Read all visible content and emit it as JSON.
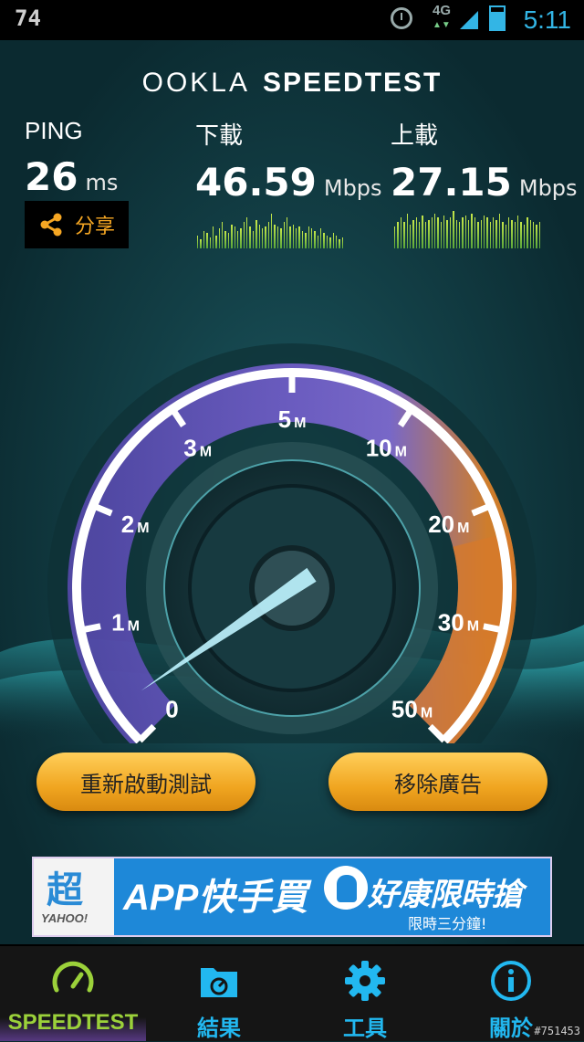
{
  "status_bar": {
    "left_number": "74",
    "network": "4G",
    "clock": "5:11"
  },
  "app": {
    "logo_brand": "OOKLA",
    "logo_product": "SPEEDTEST",
    "ping": {
      "label": "PING",
      "value": "26",
      "unit": "ms"
    },
    "download": {
      "label": "下載",
      "value": "46.59",
      "unit": "Mbps"
    },
    "upload": {
      "label": "上載",
      "value": "27.15",
      "unit": "Mbps"
    },
    "share_label": "分享",
    "download_spark": [
      0.3,
      0.2,
      0.4,
      0.35,
      0.25,
      0.5,
      0.3,
      0.45,
      0.6,
      0.4,
      0.35,
      0.55,
      0.5,
      0.4,
      0.45,
      0.6,
      0.7,
      0.5,
      0.4,
      0.65,
      0.55,
      0.45,
      0.5,
      0.6,
      0.8,
      0.55,
      0.5,
      0.45,
      0.6,
      0.7,
      0.5,
      0.55,
      0.45,
      0.5,
      0.4,
      0.35,
      0.5,
      0.45,
      0.4,
      0.3,
      0.45,
      0.35,
      0.3,
      0.25,
      0.35,
      0.3,
      0.2,
      0.25
    ],
    "upload_spark": [
      0.5,
      0.6,
      0.7,
      0.6,
      0.8,
      0.55,
      0.65,
      0.7,
      0.6,
      0.75,
      0.6,
      0.65,
      0.7,
      0.8,
      0.7,
      0.6,
      0.75,
      0.65,
      0.7,
      0.85,
      0.65,
      0.6,
      0.7,
      0.75,
      0.65,
      0.8,
      0.7,
      0.6,
      0.65,
      0.75,
      0.7,
      0.6,
      0.7,
      0.65,
      0.8,
      0.6,
      0.55,
      0.7,
      0.65,
      0.6,
      0.75,
      0.6,
      0.55,
      0.7,
      0.65,
      0.6,
      0.55,
      0.6
    ]
  },
  "gauge": {
    "ticks": [
      {
        "num": "0",
        "suffix": ""
      },
      {
        "num": "1",
        "suffix": "M"
      },
      {
        "num": "2",
        "suffix": "M"
      },
      {
        "num": "3",
        "suffix": "M"
      },
      {
        "num": "5",
        "suffix": "M"
      },
      {
        "num": "10",
        "suffix": "M"
      },
      {
        "num": "20",
        "suffix": "M"
      },
      {
        "num": "30",
        "suffix": "M"
      },
      {
        "num": "50",
        "suffix": "M"
      }
    ],
    "needle_value_fraction": 0.04,
    "colors": {
      "arc_low": "#6a56c8",
      "arc_high": "#f08a2a",
      "rim": "#ffffff",
      "needle": "#bff4ff"
    }
  },
  "buttons": {
    "retest": "重新啟動測試",
    "remove_ads": "移除廣告"
  },
  "ad": {
    "badge": "超",
    "brand": "YAHOO!",
    "headline": "APP快手買",
    "headline2": "好康限時搶",
    "subline": "限時三分鐘!"
  },
  "tabs": [
    {
      "label": "SPEEDTEST",
      "icon": "speedometer-icon"
    },
    {
      "label": "結果",
      "icon": "folder-results-icon"
    },
    {
      "label": "工具",
      "icon": "gear-icon"
    },
    {
      "label": "關於",
      "icon": "info-icon"
    }
  ],
  "watermark": "#751453"
}
